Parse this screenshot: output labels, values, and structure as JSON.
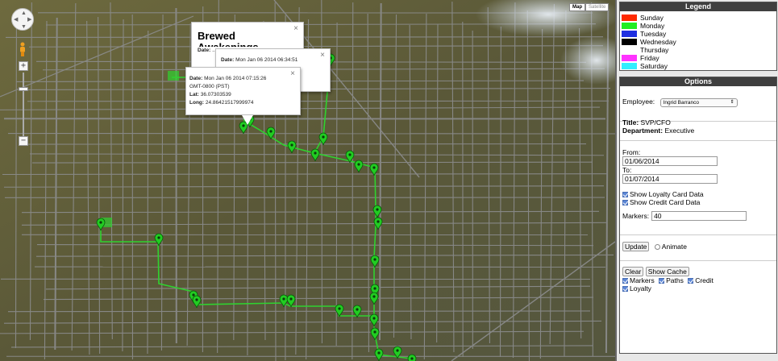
{
  "map": {
    "map_type_buttons": [
      "Map",
      "Satellite"
    ],
    "zoom_in_label": "+",
    "zoom_out_label": "−",
    "info_windows": [
      {
        "title": "Brewed Awakenings",
        "rows": [
          {
            "k": "Date:",
            "v": " Mon Jan 06 2014 06:34:51"
          },
          {
            "k": "Date:",
            "v": " ..."
          }
        ]
      },
      {
        "rows": [
          {
            "k": "Date:",
            "v": " Mon Jan 06 2014 06:3..."
          }
        ]
      },
      {
        "rows": [
          {
            "k": "Date:",
            "v": " Mon Jan 06 2014 07:15:26"
          },
          {
            "k": "",
            "v": "GMT-0800 (PST)"
          },
          {
            "k": "Lat:",
            "v": " 36.07303539"
          },
          {
            "k": "Long:",
            "v": " 24.86421517999974"
          }
        ]
      }
    ],
    "path_color": "#2fd22f",
    "marker_color": "#22cc22"
  },
  "legend": {
    "title": "Legend",
    "items": [
      {
        "label": "Sunday",
        "color": "#ff2a00"
      },
      {
        "label": "Monday",
        "color": "#22ee22"
      },
      {
        "label": "Tuesday",
        "color": "#1f2fe0"
      },
      {
        "label": "Wednesday",
        "color": "#000000"
      },
      {
        "label": "Thursday",
        "color": "#ffffff"
      },
      {
        "label": "Friday",
        "color": "#ff33ff"
      },
      {
        "label": "Saturday",
        "color": "#33eeff"
      }
    ]
  },
  "options": {
    "title": "Options",
    "employee_label": "Employee:",
    "employee_value": "Ingrid Barranco",
    "title_label": "Title:",
    "title_value": "SVP/CFO",
    "department_label": "Department:",
    "department_value": "Executive",
    "from_label": "From:",
    "from_value": "01/06/2014",
    "to_label": "To:",
    "to_value": "01/07/2014",
    "show_loyalty": "Show Loyalty Card Data",
    "show_credit": "Show Credit Card Data",
    "markers_label": "Markers:",
    "markers_value": "40",
    "update_label": "Update",
    "animate_label": "Animate",
    "clear_label": "Clear",
    "show_cache_label": "Show Cache",
    "filter_markers": "Markers",
    "filter_paths": "Paths",
    "filter_credit": "Credit",
    "filter_loyalty": "Loyalty"
  }
}
